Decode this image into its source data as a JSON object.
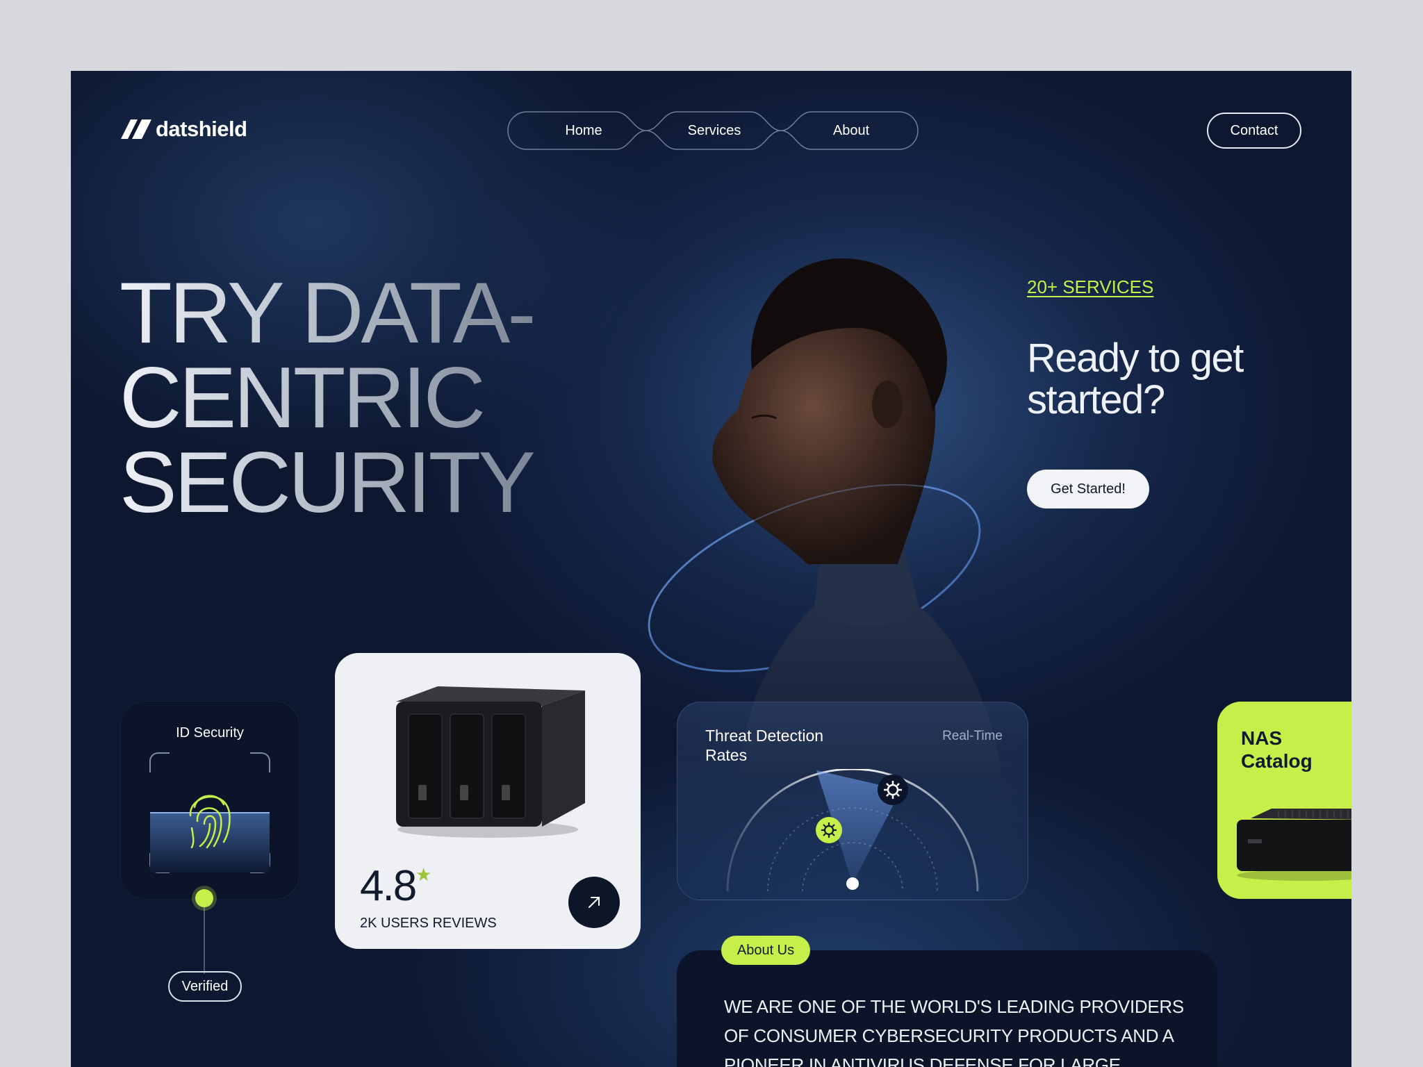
{
  "brand": {
    "name": "datshield"
  },
  "nav": {
    "items": [
      "Home",
      "Services",
      "About"
    ],
    "contact": "Contact"
  },
  "hero": {
    "title_lines": [
      "TRY DATA-",
      "CENTRIC",
      "SECURITY"
    ],
    "services_link": "20+ SERVICES",
    "headline_lines": [
      "Ready to get",
      "started?"
    ],
    "cta": "Get Started!"
  },
  "id_card": {
    "title": "ID Security",
    "status": "Verified",
    "icon": "fingerprint-icon"
  },
  "rating_card": {
    "value": "4.8",
    "star": "★",
    "caption": "2K USERS REVIEWS",
    "action_icon": "arrow-up-right-icon"
  },
  "threat_card": {
    "title_lines": [
      "Threat Detection",
      "Rates"
    ],
    "tag": "Real-Time",
    "icons": [
      "virus-icon",
      "bug-icon"
    ]
  },
  "nas_catalog": {
    "title_lines": [
      "NAS",
      "Catalog"
    ]
  },
  "about": {
    "tag": "About Us",
    "text_lines": [
      "WE ARE ONE OF THE WORLD'S LEADING PROVIDERS",
      "OF CONSUMER CYBERSECURITY PRODUCTS AND A",
      "PIONEER IN ANTIVIRUS DEFENSE FOR LARGE"
    ]
  },
  "colors": {
    "accent": "#c6ef4a",
    "background": "#0d1730",
    "card_dark": "#0b1428",
    "card_light": "#eef0f3"
  }
}
